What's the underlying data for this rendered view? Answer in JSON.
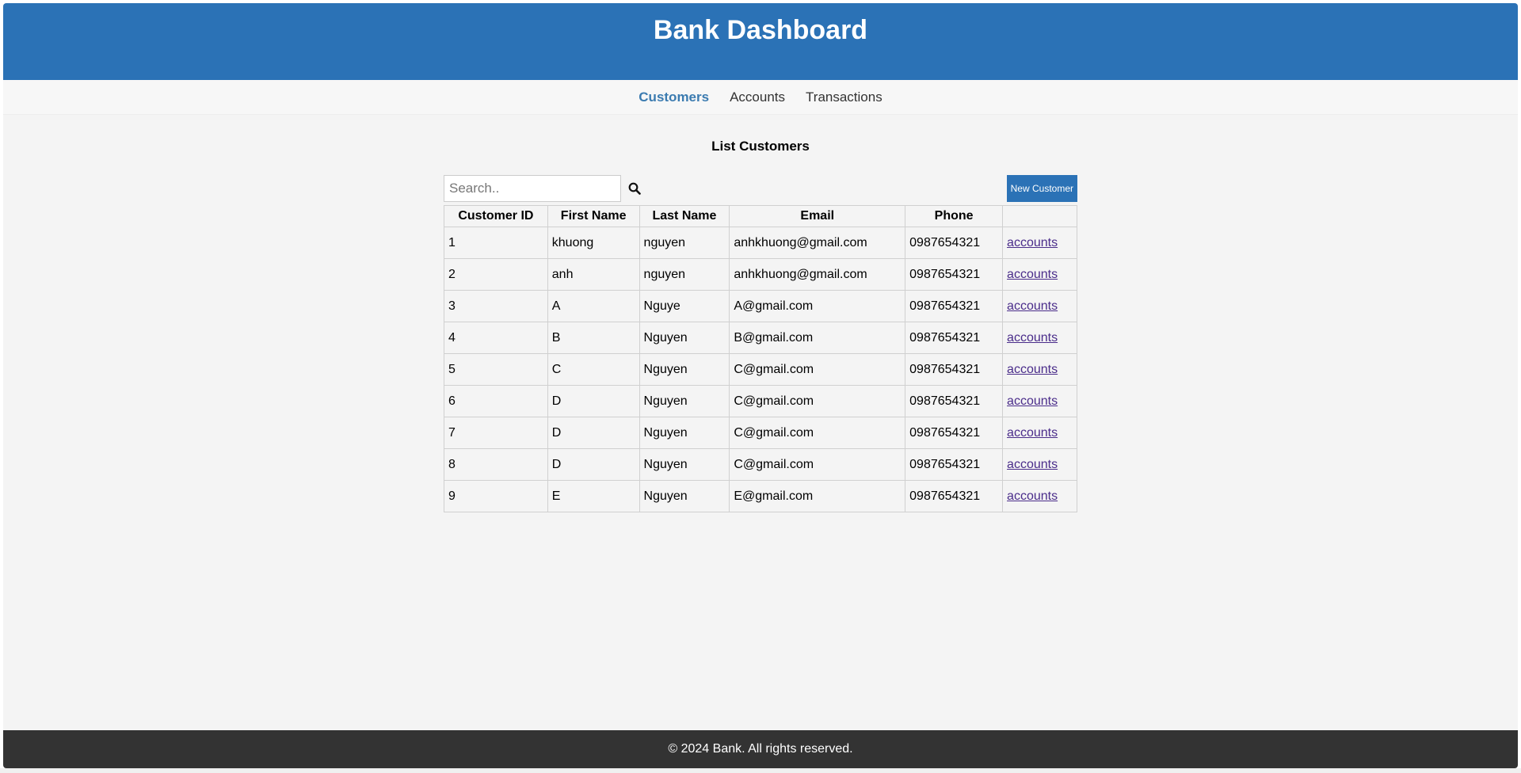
{
  "header": {
    "title": "Bank Dashboard"
  },
  "nav": {
    "items": [
      {
        "label": "Customers",
        "active": true
      },
      {
        "label": "Accounts",
        "active": false
      },
      {
        "label": "Transactions",
        "active": false
      }
    ]
  },
  "main": {
    "title": "List Customers",
    "search": {
      "placeholder": "Search..",
      "value": ""
    },
    "new_button_label": "New Customer",
    "table": {
      "headers": [
        "Customer ID",
        "First Name",
        "Last Name",
        "Email",
        "Phone",
        ""
      ],
      "rows": [
        {
          "id": "1",
          "first": "khuong",
          "last": "nguyen",
          "email": "anhkhuong@gmail.com",
          "phone": "0987654321",
          "link": "accounts"
        },
        {
          "id": "2",
          "first": "anh",
          "last": "nguyen",
          "email": "anhkhuong@gmail.com",
          "phone": "0987654321",
          "link": "accounts"
        },
        {
          "id": "3",
          "first": "A",
          "last": "Nguye",
          "email": "A@gmail.com",
          "phone": "0987654321",
          "link": "accounts"
        },
        {
          "id": "4",
          "first": "B",
          "last": "Nguyen",
          "email": "B@gmail.com",
          "phone": "0987654321",
          "link": "accounts"
        },
        {
          "id": "5",
          "first": "C",
          "last": "Nguyen",
          "email": "C@gmail.com",
          "phone": "0987654321",
          "link": "accounts"
        },
        {
          "id": "6",
          "first": "D",
          "last": "Nguyen",
          "email": "C@gmail.com",
          "phone": "0987654321",
          "link": "accounts"
        },
        {
          "id": "7",
          "first": "D",
          "last": "Nguyen",
          "email": "C@gmail.com",
          "phone": "0987654321",
          "link": "accounts"
        },
        {
          "id": "8",
          "first": "D",
          "last": "Nguyen",
          "email": "C@gmail.com",
          "phone": "0987654321",
          "link": "accounts"
        },
        {
          "id": "9",
          "first": "E",
          "last": "Nguyen",
          "email": "E@gmail.com",
          "phone": "0987654321",
          "link": "accounts"
        }
      ]
    }
  },
  "footer": {
    "text": "© 2024 Bank. All rights reserved."
  },
  "icons": {
    "search": "search-icon"
  },
  "colors": {
    "primary": "#2b72b6",
    "footer": "#333333",
    "nav_active": "#3b7bb0"
  }
}
